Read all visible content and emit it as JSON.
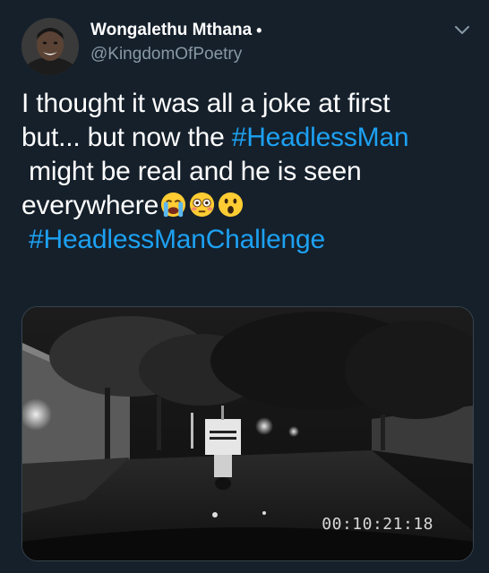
{
  "author": {
    "name": "Wongalethu Mthana",
    "dot": "•",
    "handle": "@KingdomOfPoetry"
  },
  "tweet": {
    "line1": "I thought it was all a joke at first",
    "line2_text": "but... but now the ",
    "hashtag1": "#HeadlessMan",
    "line3": " might be real and he is seen",
    "line4_text": "everywhere",
    "emojis": [
      "loudly-crying-face",
      "flushed-face",
      "astonished-face"
    ],
    "hashtag2": "#HeadlessManChallenge"
  },
  "media": {
    "timestamp": "00:10:21:18"
  },
  "colors": {
    "background": "#15202b",
    "hashtag": "#1da1f2",
    "secondary_text": "#8899a6"
  }
}
